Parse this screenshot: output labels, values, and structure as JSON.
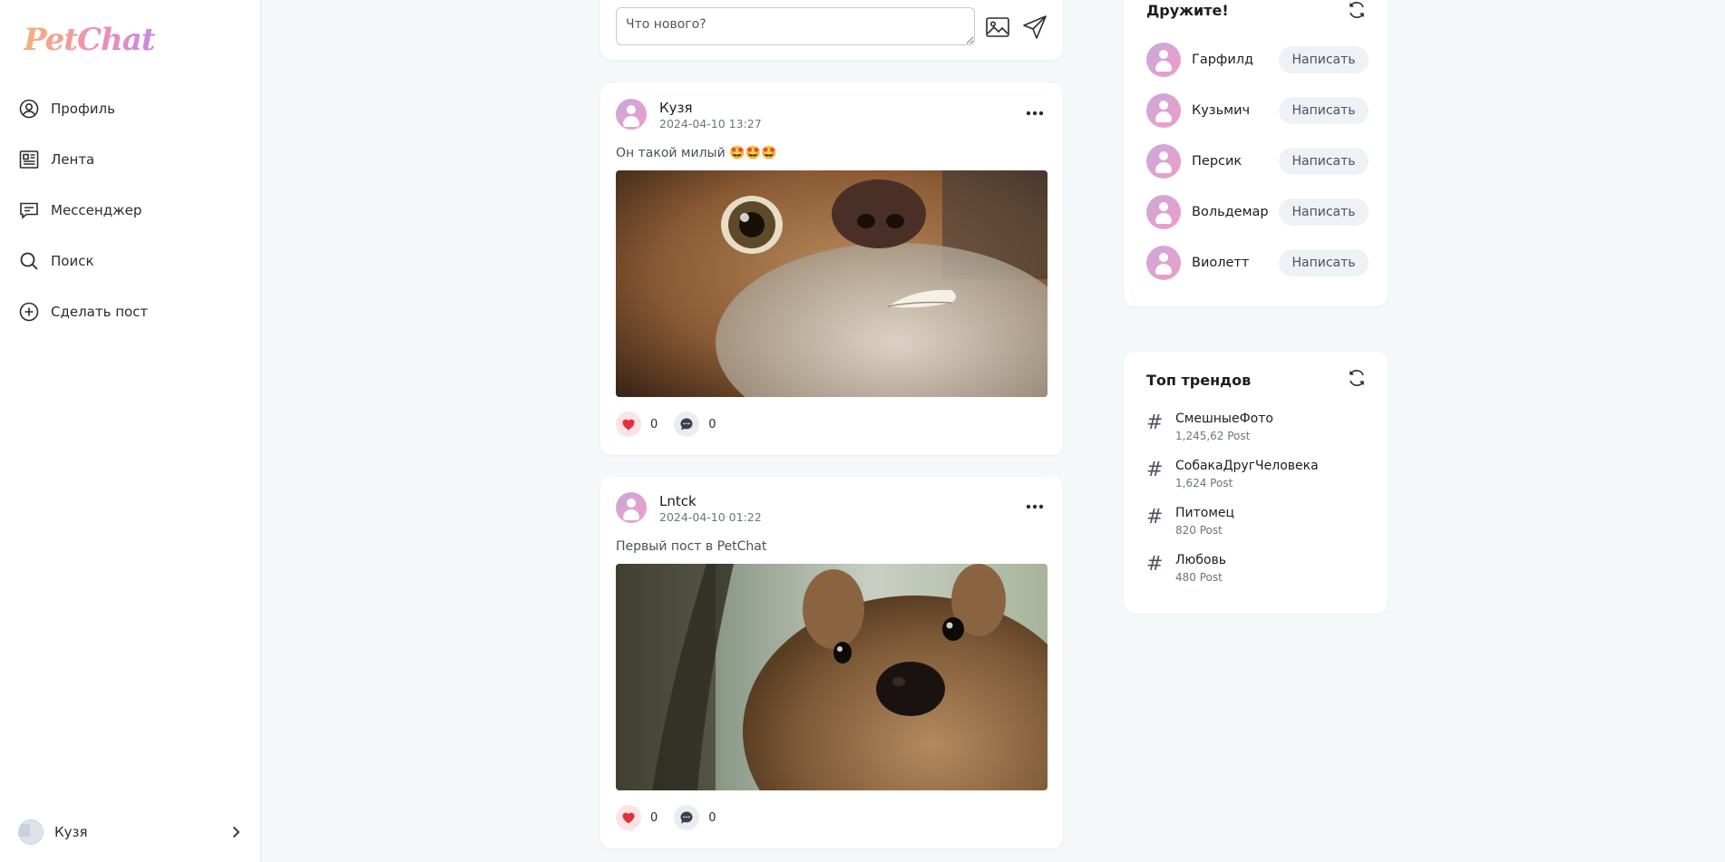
{
  "app": {
    "logo": "PetChat"
  },
  "sidebar": {
    "items": [
      {
        "label": "Профиль",
        "icon": "user-circle-icon"
      },
      {
        "label": "Лента",
        "icon": "newspaper-icon"
      },
      {
        "label": "Мессенджер",
        "icon": "chat-icon"
      },
      {
        "label": "Поиск",
        "icon": "search-icon"
      },
      {
        "label": "Сделать пост",
        "icon": "plus-circle-icon"
      }
    ],
    "user": {
      "name": "Кузя"
    }
  },
  "composer": {
    "placeholder": "Что нового?"
  },
  "posts": [
    {
      "author": "Кузя",
      "date": "2024-04-10 13:27",
      "text": "Он такой милый 🤩🤩🤩",
      "likes": "0",
      "comments": "0",
      "image": "dog-photo"
    },
    {
      "author": "Lntck",
      "date": "2024-04-10 01:22",
      "text": "Первый пост в PetChat",
      "likes": "0",
      "comments": "0",
      "image": "quokka-photo"
    }
  ],
  "friends": {
    "title": "Дружите!",
    "write_label": "Написать",
    "items": [
      {
        "name": "Гарфилд"
      },
      {
        "name": "Кузьмич"
      },
      {
        "name": "Персик"
      },
      {
        "name": "Вольдемар"
      },
      {
        "name": "Виолетт"
      }
    ]
  },
  "trends": {
    "title": "Топ трендов",
    "items": [
      {
        "tag": "СмешныеФото",
        "count": "1,245,62 Post"
      },
      {
        "tag": "СобакаДругЧеловека",
        "count": "1,624 Post"
      },
      {
        "tag": "Питомец",
        "count": "820 Post"
      },
      {
        "tag": "Любовь",
        "count": "480 Post"
      }
    ]
  },
  "colors": {
    "accent_pink": "#f09cc5",
    "accent_purple": "#c9a9dc",
    "like_red": "#e0303e",
    "background": "#f5f8fb"
  }
}
